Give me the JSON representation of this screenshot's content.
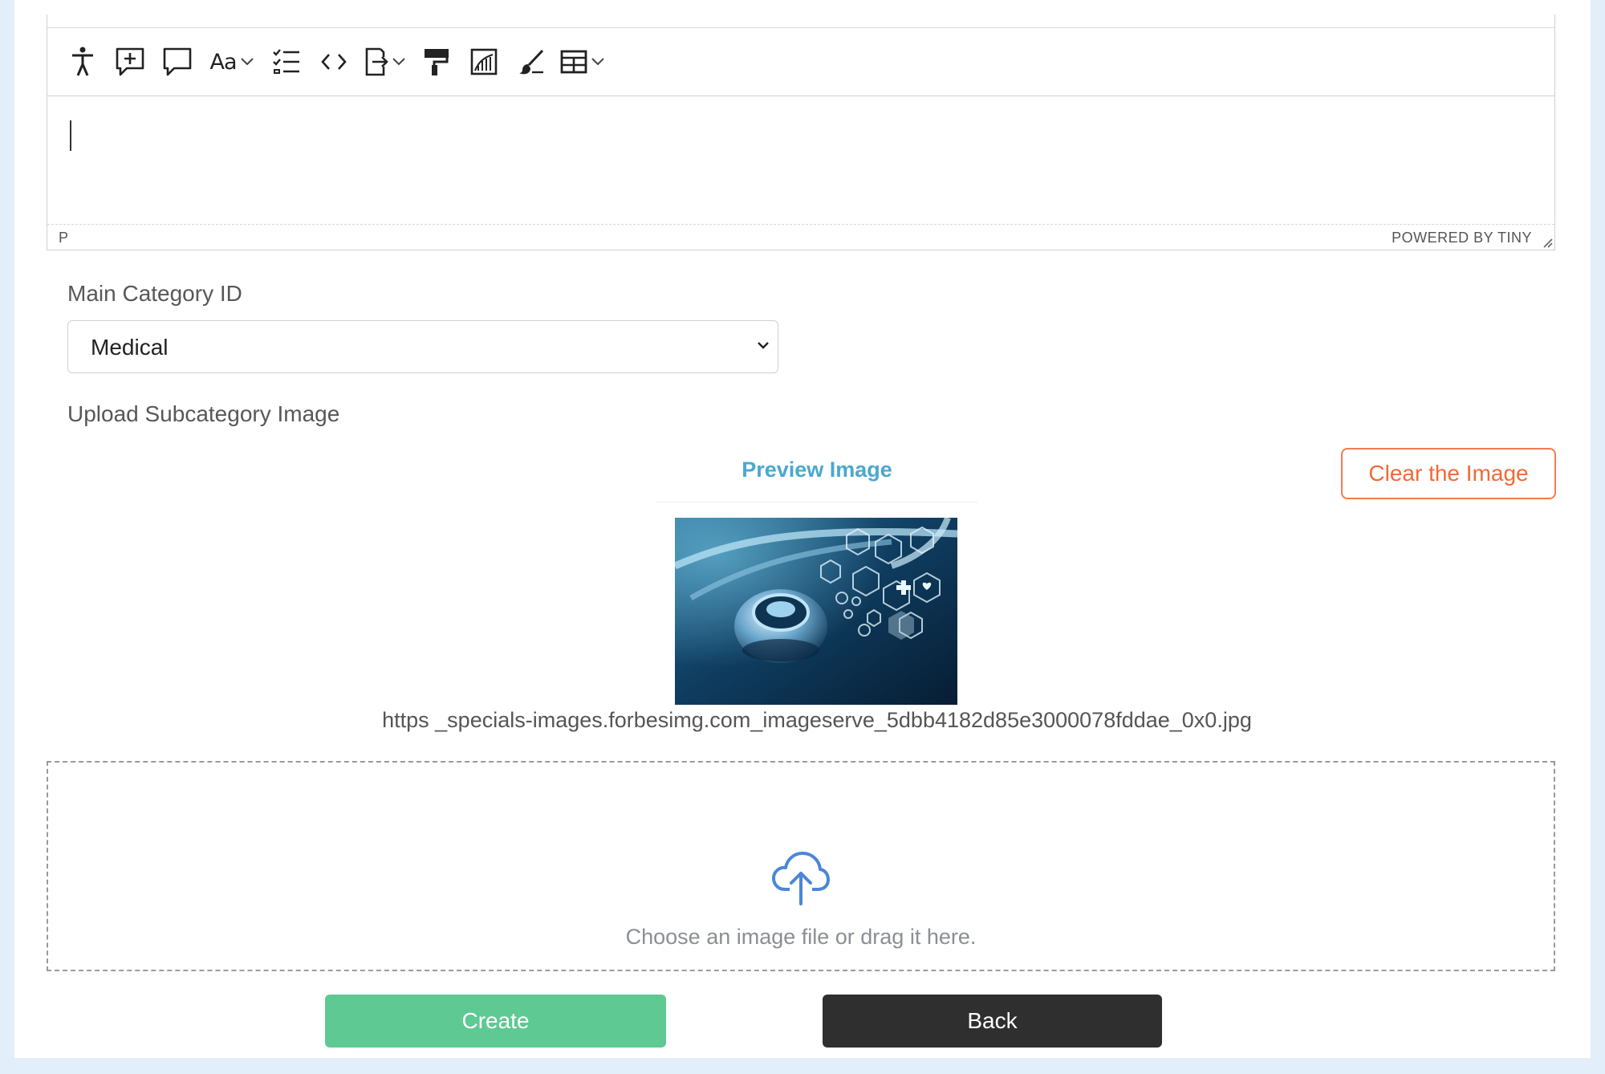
{
  "editor": {
    "toolbar": {
      "items": [
        {
          "icon": "accessibility-icon"
        },
        {
          "icon": "add-comment-icon"
        },
        {
          "icon": "comment-icon"
        },
        {
          "icon": "font-size-icon",
          "label": "Aa",
          "has_dropdown": true
        },
        {
          "icon": "checklist-icon"
        },
        {
          "icon": "source-code-icon"
        },
        {
          "icon": "export-icon",
          "has_dropdown": true
        },
        {
          "icon": "format-painter-icon"
        },
        {
          "icon": "chart-icon"
        },
        {
          "icon": "brush-icon"
        },
        {
          "icon": "table-icon",
          "has_dropdown": true
        }
      ]
    },
    "status": {
      "path": "P",
      "branding": "POWERED BY TINY"
    }
  },
  "form": {
    "category": {
      "label": "Main Category ID",
      "selected": "Medical"
    },
    "upload": {
      "label": "Upload Subcategory Image",
      "preview_title": "Preview Image",
      "clear_label": "Clear the Image",
      "filename": "https _specials-images.forbesimg.com_imageserve_5dbb4182d85e3000078fddae_0x0.jpg",
      "dropzone_text": "Choose an image file or drag it here."
    },
    "actions": {
      "create_label": "Create",
      "back_label": "Back"
    }
  },
  "colors": {
    "page_background": "#e2effb",
    "preview_title": "#4aa8cf",
    "clear_button": "#f06a35",
    "create_button": "#5ec993",
    "back_button": "#2f2f2f",
    "upload_icon": "#4b87d6"
  }
}
